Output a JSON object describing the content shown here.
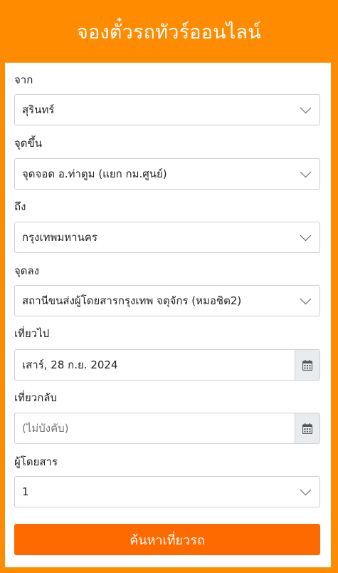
{
  "header": {
    "title": "จองตั๋วรถทัวร์ออนไลน์"
  },
  "form": {
    "from_label": "จาก",
    "from_value": "สุรินทร์",
    "pickup_label": "จุดขึ้น",
    "pickup_value": "จุดจอด อ.ท่าตูม (แยก กม.ศูนย์)",
    "to_label": "ถึง",
    "to_value": "กรุงเทพมหานคร",
    "dropoff_label": "จุดลง",
    "dropoff_value": "สถานีขนส่งผู้โดยสารกรุงเทพ จตุจักร (หมอชิต2)",
    "depart_label": "เที่ยวไป",
    "depart_value": "เสาร์, 28 ก.ย. 2024",
    "return_label": "เที่ยวกลับ",
    "return_placeholder": "(ไม่บังคับ)",
    "passengers_label": "ผู้โดยสาร",
    "passengers_value": "1",
    "search_button": "ค้นหาเที่ยวรถ"
  },
  "icons": {
    "calendar": "calendar-icon",
    "chevron": "chevron-down-icon"
  },
  "colors": {
    "accent": "#ff8c00",
    "button": "#ff6a00"
  }
}
